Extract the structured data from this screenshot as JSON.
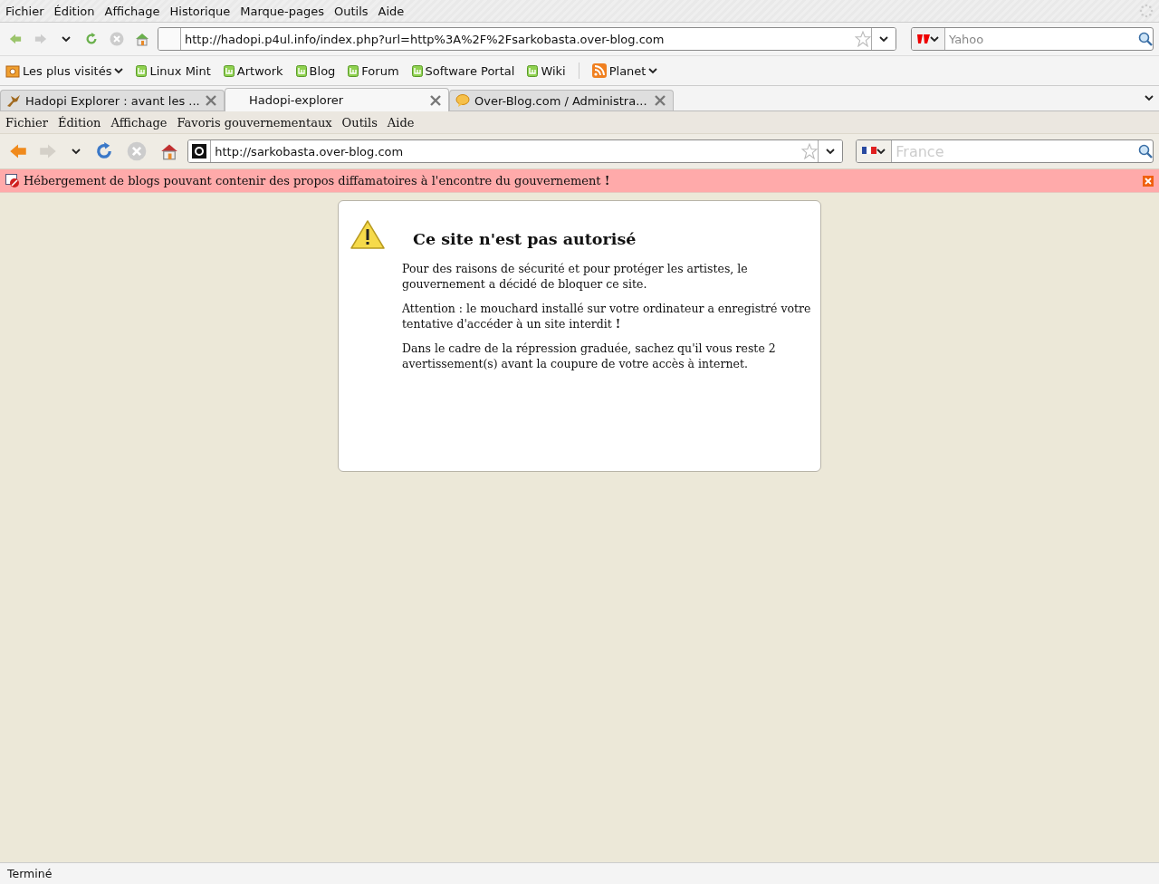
{
  "menu_bar": [
    "Fichier",
    "Édition",
    "Affichage",
    "Historique",
    "Marque-pages",
    "Outils",
    "Aide"
  ],
  "navigation": {
    "url": "http://hadopi.p4ul.info/index.php?url=http%3A%2F%2Fsarkobasta.over-blog.com",
    "search": {
      "placeholder": "Yahoo"
    }
  },
  "bookmarks": [
    {
      "label": "Les plus visités",
      "kind": "folder"
    },
    {
      "label": "Linux Mint",
      "kind": "mint"
    },
    {
      "label": "Artwork",
      "kind": "mint"
    },
    {
      "label": "Blog",
      "kind": "mint"
    },
    {
      "label": "Forum",
      "kind": "mint"
    },
    {
      "label": "Software Portal",
      "kind": "mint"
    },
    {
      "label": "Wiki",
      "kind": "mint"
    },
    {
      "label": "Planet",
      "kind": "feed"
    }
  ],
  "tabs": [
    {
      "title": "Hadopi Explorer : avant les ...",
      "selected": false
    },
    {
      "title": "Hadopi-explorer",
      "selected": true
    },
    {
      "title": "Over-Blog.com / Administra...",
      "selected": false
    }
  ],
  "inner_browser": {
    "menu_bar": [
      "Fichier",
      "Édition",
      "Affichage",
      "Favoris gouvernementaux",
      "Outils",
      "Aide"
    ],
    "url": "http://sarkobasta.over-blog.com",
    "search": {
      "placeholder": "France"
    },
    "notification": "Hébergement de blogs pouvant contenir des propos diffamatoires à l'encontre du gouvernement **!**",
    "error_page": {
      "title": "Ce site n'est pas autorisé",
      "paragraphs": [
        "Pour des raisons de sécurité et pour protéger les artistes, le gouvernement a décidé de bloquer ce site.",
        "Attention : le mouchard installé sur votre ordinateur a enregistré votre tentative d'accéder à un site interdit **!**",
        "Dans le cadre de la répression graduée, sachez qu'il vous reste 2 avertissement(s) avant la coupure de votre accès à internet."
      ]
    }
  },
  "status_bar": "Terminé"
}
